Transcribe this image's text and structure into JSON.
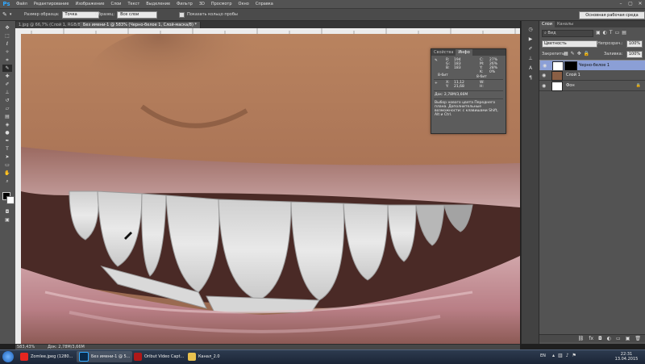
{
  "app": {
    "logo": "Ps"
  },
  "menu": [
    "Файл",
    "Редактирование",
    "Изображение",
    "Слои",
    "Текст",
    "Выделение",
    "Фильтр",
    "3D",
    "Просмотр",
    "Окно",
    "Справка"
  ],
  "options": {
    "size_label": "Размер образца:",
    "size_value": "Точка",
    "sample_label": "Образец:",
    "sample_value": "Все слои",
    "show_ring": "Показать кольцо пробы"
  },
  "workspace": "Основная рабочая среда",
  "tabs": [
    "1.jpg @ 66,7% (Слой 1, RGB/8) *",
    "Без имени-1 @ 583% (Черно-белое 1, Слой-маска/8) *"
  ],
  "status": {
    "zoom": "583,43%",
    "doc": "Док: 2,78М/3,66М"
  },
  "info": {
    "tabs": [
      "Свойства",
      "Инфо"
    ],
    "rgb_left": {
      "R": "194",
      "G": "183",
      "B": "183"
    },
    "rgb_right": {
      "R": "194",
      "G": "183",
      "B": "183"
    },
    "cmyk_left": {
      "C": "27%",
      "M": "26%",
      "Y": "28%",
      "K": "0%"
    },
    "cmyk_right": {
      "C": "27%",
      "M": "26%",
      "Y": "28%",
      "K": "0%"
    },
    "bits_left": "8-бит",
    "bits_right": "8-бит",
    "xy": {
      "X": "11,12",
      "Y": "21,68"
    },
    "wh": {
      "W": "",
      "H": ""
    },
    "doc": "Док: 2,78M/3,66M",
    "hint": "Выбор нового цвета Переднего плана. Дополнительные возможности: с клавишами Shift, Alt и Ctrl."
  },
  "layers": {
    "tabs": [
      "Слои",
      "Каналы"
    ],
    "filter": "Вид",
    "blend": "Цветность",
    "opacity_label": "Непрозрач.:",
    "opacity": "100%",
    "lock_label": "Закрепить:",
    "fill_label": "Заливка:",
    "fill": "100%",
    "items": [
      {
        "name": "Черно-белое 1",
        "selected": true
      },
      {
        "name": "Слой 1",
        "selected": false
      },
      {
        "name": "Фон",
        "selected": false
      }
    ]
  },
  "taskbar": {
    "items": [
      {
        "label": "Zomlee.jpeg (1280..."
      },
      {
        "label": "Без имени-1 @ 5..."
      },
      {
        "label": "Oribut Video Capt..."
      },
      {
        "label": "Канал_2.0"
      }
    ],
    "lang": "EN",
    "time": "22:31",
    "date": "13.04.2015"
  }
}
